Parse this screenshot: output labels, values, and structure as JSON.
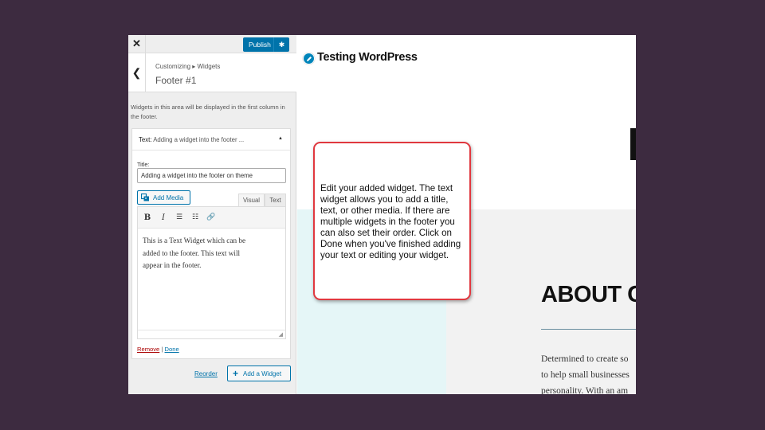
{
  "topbar": {
    "close_icon": "close-icon",
    "close_glyph": "✕",
    "publish_label": "Publish",
    "gear_glyph": "✱"
  },
  "section_header": {
    "back_glyph": "❮",
    "breadcrumb": "Customizing ▸ Widgets",
    "title": "Footer #1"
  },
  "description": "Widgets in this area will be displayed in the first column in the footer.",
  "widget": {
    "type_label": "Text:",
    "title_summary": "Adding a widget into the footer ...",
    "toggle_glyph": "▲",
    "title_label": "Title:",
    "title_value": "Adding a widget into the footer on theme",
    "add_media_label": "Add Media",
    "tab_visual": "Visual",
    "tab_text": "Text",
    "toolbar": {
      "bold": "B",
      "italic": "I",
      "bullet_list": "☰",
      "numbered_list": "☷",
      "link": "🔗"
    },
    "content_lines": [
      "This is a Text Widget which can be",
      "added to the footer.  This text will",
      "appear in the footer."
    ],
    "resize_glyph": "◢",
    "remove_label": "Remove",
    "separator": "|",
    "done_label": "Done"
  },
  "footer_actions": {
    "reorder_label": "Reorder",
    "add_widget_plus": "+",
    "add_widget_label": "Add a Widget"
  },
  "preview": {
    "site_title": "Testing WordPress",
    "about_heading": "ABOUT C",
    "about_lines": [
      "Determined to create so",
      "to help small businesses",
      "personality. With an am"
    ]
  },
  "callout": {
    "text": "Edit your added widget.  The text widget allows you to add a title, text, or other media.  If there are multiple widgets in the footer you can also set their order.  Click on Done when you've finished adding your text or editing your widget."
  },
  "colors": {
    "accent": "#0073aa",
    "callout_border": "#e0383f",
    "background": "#3d2b40"
  }
}
